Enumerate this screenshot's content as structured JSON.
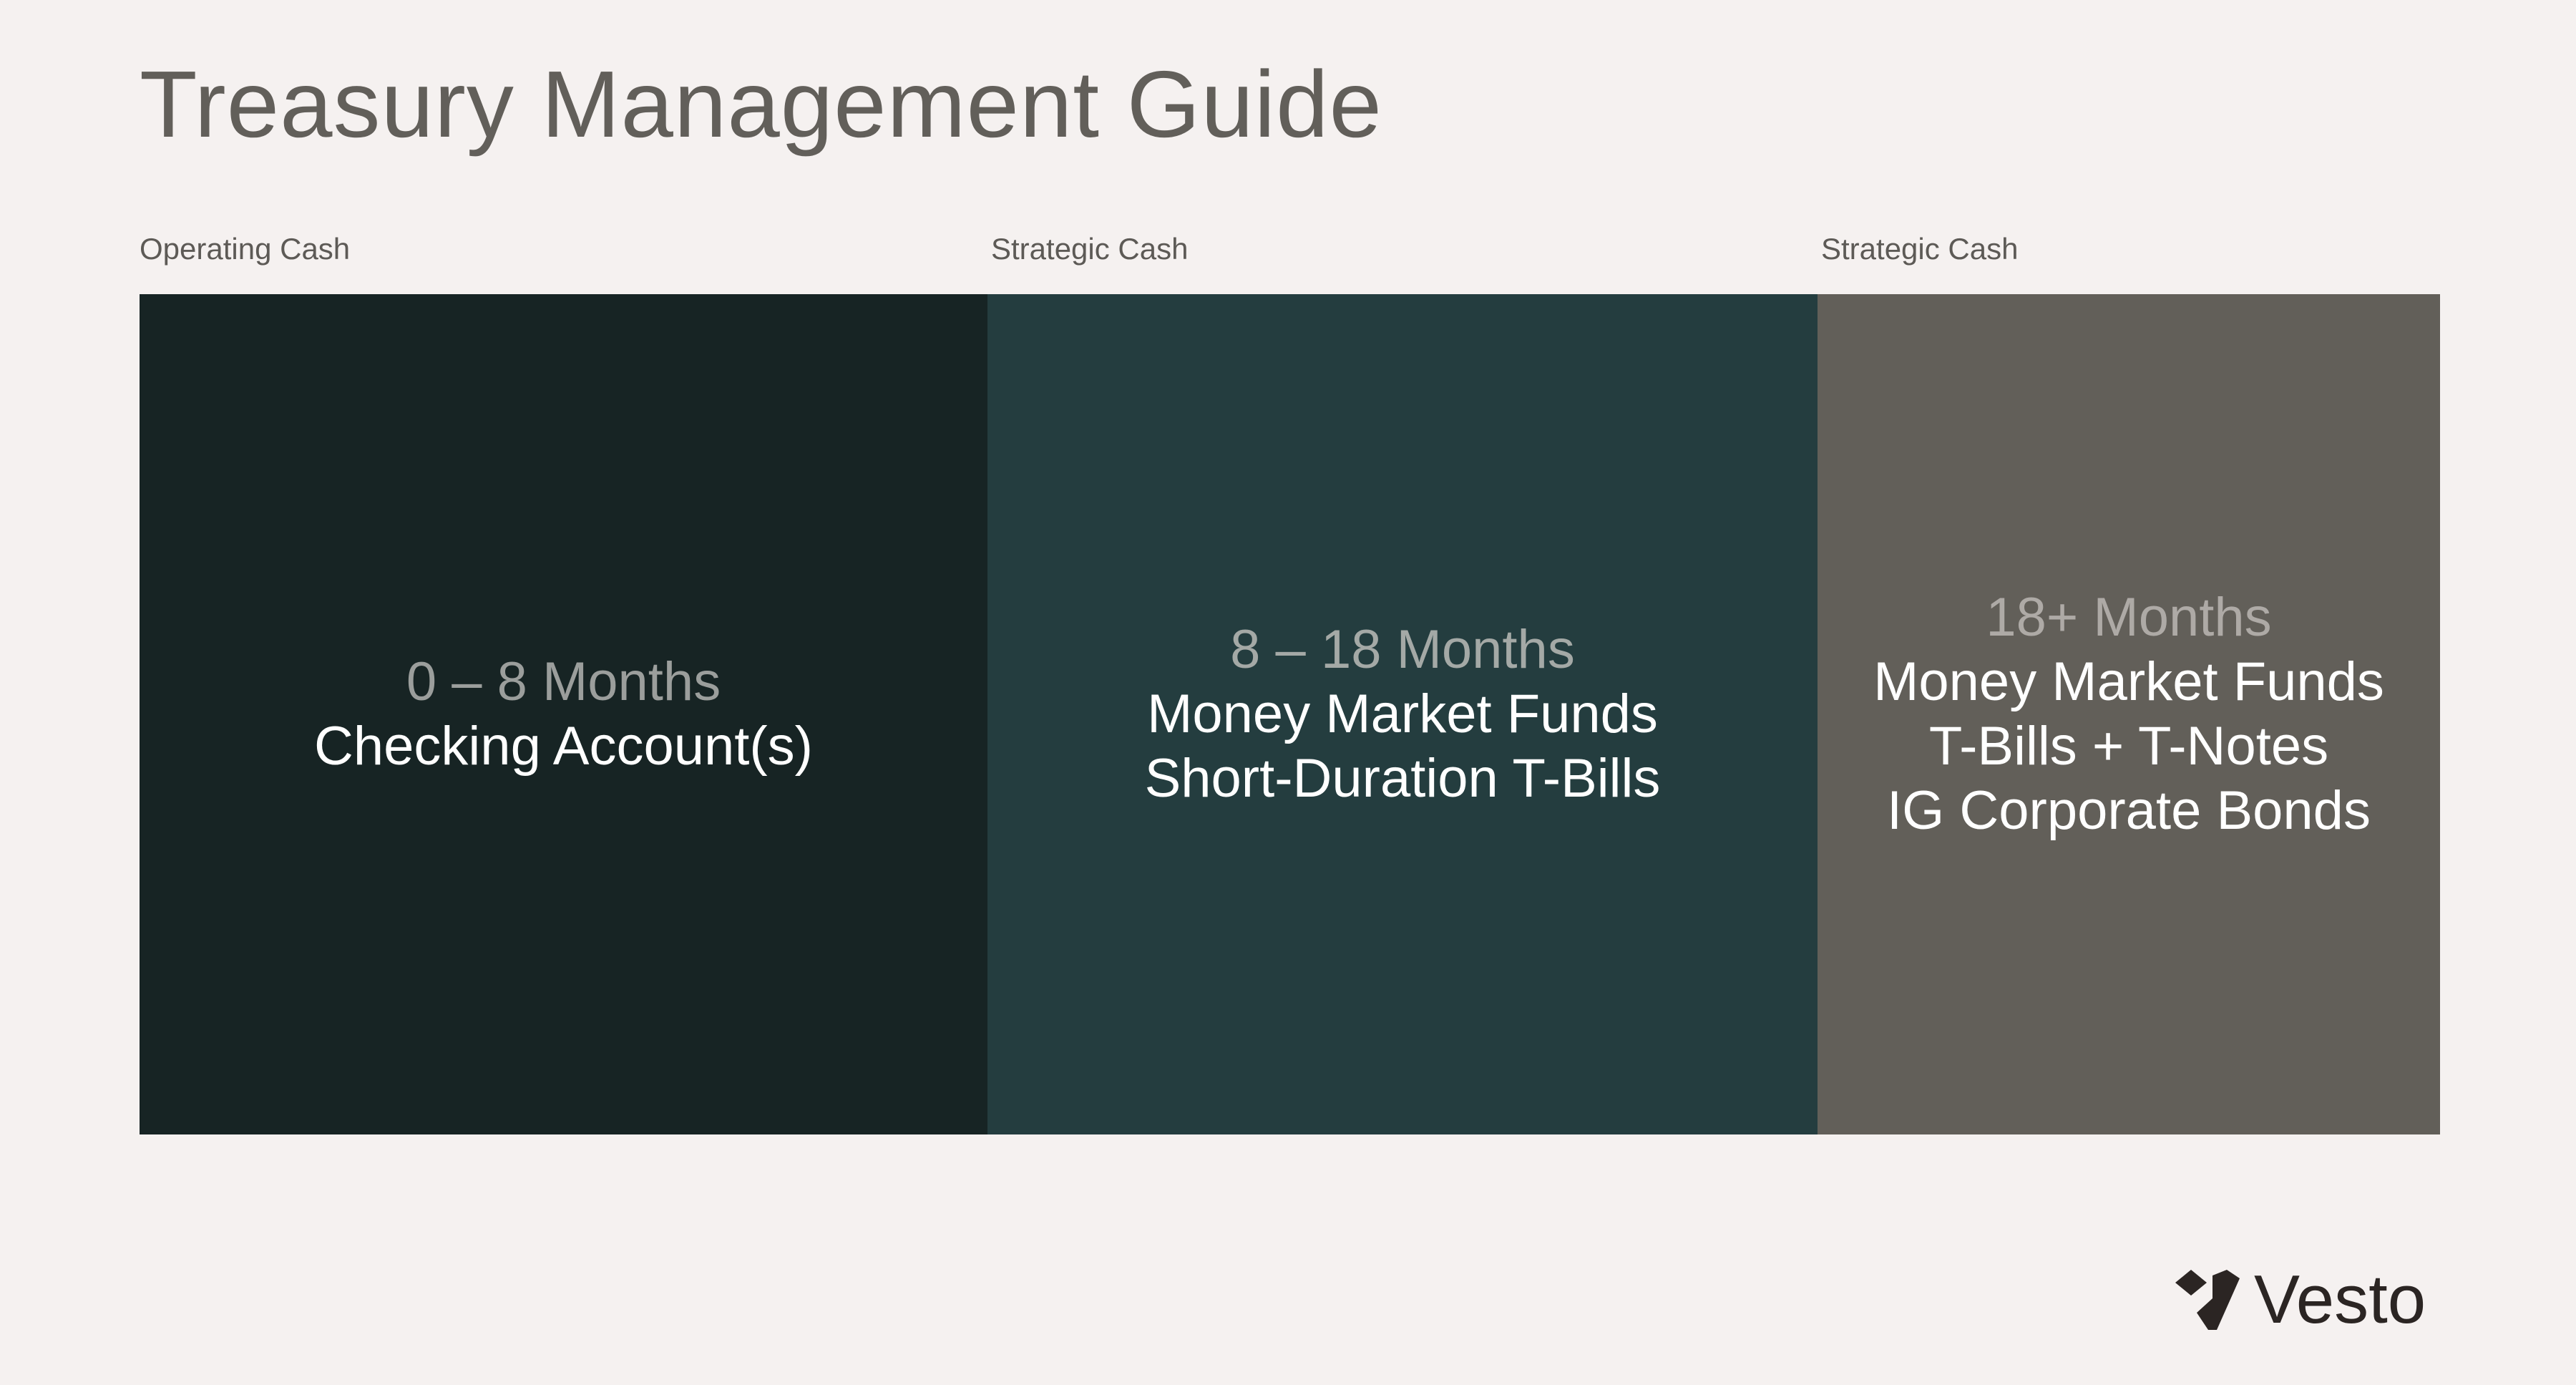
{
  "title": "Treasury Management Guide",
  "colors": {
    "background": "#f5f1f0",
    "title_text": "#625f5a",
    "label_text": "#5d5a56",
    "instrument_text": "#ffffff",
    "brand_text": "#2b2523"
  },
  "sections": [
    {
      "label": "Operating Cash",
      "duration": "0 – 8 Months",
      "instruments": [
        "Checking Account(s)"
      ],
      "fill_color": "#172424",
      "duration_color": "#9b9e9c"
    },
    {
      "label": "Strategic Cash",
      "duration": "8 – 18 Months",
      "instruments": [
        "Money Market Funds",
        "Short-Duration T-Bills"
      ],
      "fill_color": "#243d3f",
      "duration_color": "#a4a9a6"
    },
    {
      "label": "Strategic Cash",
      "duration": "18+ Months",
      "instruments": [
        "Money Market Funds",
        "T-Bills + T-Notes",
        "IG Corporate Bonds"
      ],
      "fill_color": "#625f59",
      "duration_color": "#aeaaa6"
    }
  ],
  "brand": {
    "name": "Vesto",
    "icon": "vesto-logo-icon"
  }
}
